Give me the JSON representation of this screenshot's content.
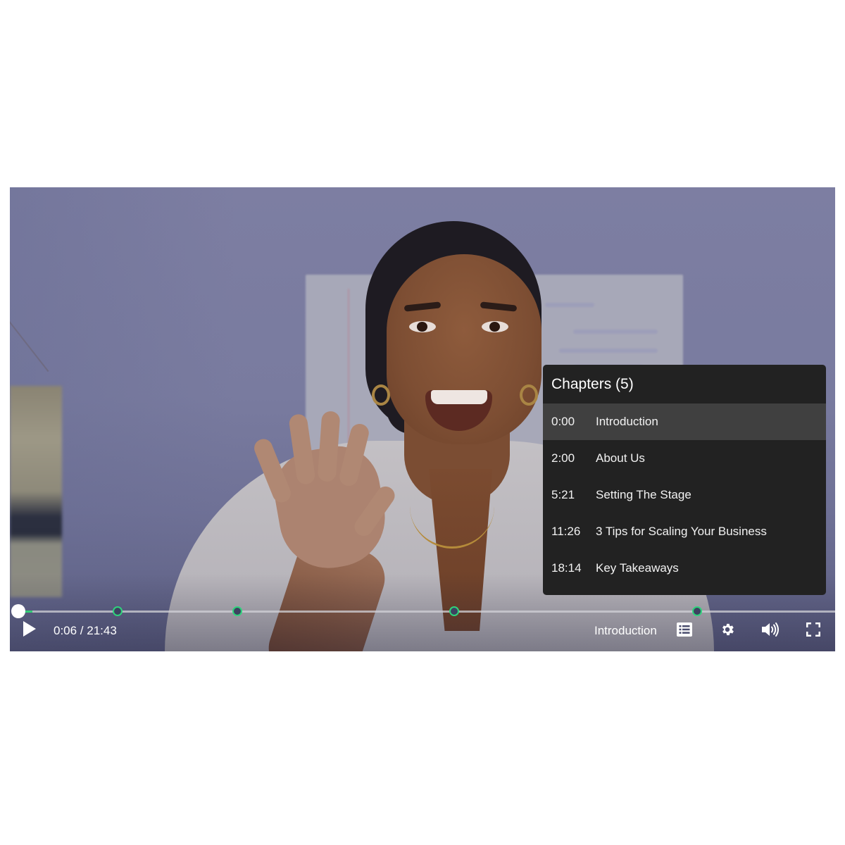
{
  "player": {
    "current_time": "0:06",
    "duration": "21:43",
    "time_display": "0:06 / 21:43",
    "current_chapter": "Introduction",
    "progress_seconds": 6,
    "duration_seconds": 1303,
    "accent_color": "#33cc77"
  },
  "chapters": {
    "title": "Chapters (5)",
    "items": [
      {
        "time": "0:00",
        "title": "Introduction",
        "seconds": 0,
        "active": true
      },
      {
        "time": "2:00",
        "title": "About Us",
        "seconds": 120,
        "active": false
      },
      {
        "time": "5:21",
        "title": "Setting The Stage",
        "seconds": 321,
        "active": false
      },
      {
        "time": "11:26",
        "title": "3 Tips for Scaling Your Business",
        "seconds": 686,
        "active": false
      },
      {
        "time": "18:14",
        "title": "Key Takeaways",
        "seconds": 1094,
        "active": false
      }
    ]
  },
  "controls": {
    "play": "play-icon",
    "chapters": "chapters-list-icon",
    "settings": "gear-icon",
    "volume": "volume-icon",
    "fullscreen": "fullscreen-icon"
  }
}
